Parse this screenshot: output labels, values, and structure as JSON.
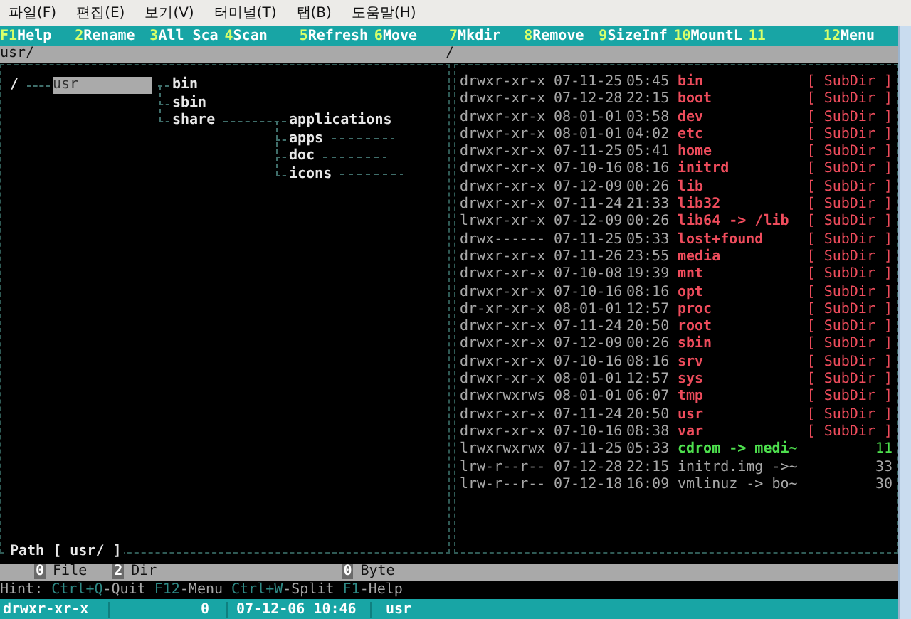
{
  "menu": [
    "파일(F)",
    "편집(E)",
    "보기(V)",
    "터미널(T)",
    "탭(B)",
    "도움말(H)"
  ],
  "function_keys": [
    {
      "key": "F1",
      "label": "Help"
    },
    {
      "key": "2",
      "label": "Rename"
    },
    {
      "key": "3",
      "label": "All Sca"
    },
    {
      "key": "4",
      "label": "Scan"
    },
    {
      "key": "5",
      "label": "Refresh"
    },
    {
      "key": "6",
      "label": "Move"
    },
    {
      "key": "7",
      "label": "Mkdir"
    },
    {
      "key": "8",
      "label": "Remove"
    },
    {
      "key": "9",
      "label": "SizeInf"
    },
    {
      "key": "10",
      "label": "MountL"
    },
    {
      "key": "11"
    },
    {
      "key": "12",
      "label": "Menu"
    }
  ],
  "path_bar": {
    "left": "usr/",
    "right": "/"
  },
  "tree": {
    "path_label": "Path [ usr/ ]",
    "nodes": [
      {
        "label": "/",
        "selected": false,
        "collapsed": false,
        "children": [
          {
            "label": "usr",
            "selected": true,
            "collapsed": false,
            "children": [
              {
                "label": "bin",
                "selected": false,
                "collapsed": false
              },
              {
                "label": "sbin",
                "selected": false,
                "collapsed": false
              },
              {
                "label": "share",
                "selected": false,
                "collapsed": false,
                "children": [
                  {
                    "label": "applications",
                    "selected": false,
                    "collapsed": false
                  },
                  {
                    "label": "apps",
                    "selected": false,
                    "collapsed": true
                  },
                  {
                    "label": "doc",
                    "selected": false,
                    "collapsed": true
                  },
                  {
                    "label": "icons",
                    "selected": false,
                    "collapsed": true
                  }
                ]
              }
            ]
          }
        ]
      }
    ]
  },
  "files": [
    {
      "perm": "drwxr-xr-x",
      "date": "07-11-25",
      "time": "05:45",
      "name": "bin",
      "info": "[ SubDir ]",
      "kind": "dir"
    },
    {
      "perm": "drwxr-xr-x",
      "date": "07-12-28",
      "time": "22:15",
      "name": "boot",
      "info": "[ SubDir ]",
      "kind": "dir"
    },
    {
      "perm": "drwxr-xr-x",
      "date": "08-01-01",
      "time": "03:58",
      "name": "dev",
      "info": "[ SubDir ]",
      "kind": "dir"
    },
    {
      "perm": "drwxr-xr-x",
      "date": "08-01-01",
      "time": "04:02",
      "name": "etc",
      "info": "[ SubDir ]",
      "kind": "dir"
    },
    {
      "perm": "drwxr-xr-x",
      "date": "07-11-25",
      "time": "05:41",
      "name": "home",
      "info": "[ SubDir ]",
      "kind": "dir"
    },
    {
      "perm": "drwxr-xr-x",
      "date": "07-10-16",
      "time": "08:16",
      "name": "initrd",
      "info": "[ SubDir ]",
      "kind": "dir"
    },
    {
      "perm": "drwxr-xr-x",
      "date": "07-12-09",
      "time": "00:26",
      "name": "lib",
      "info": "[ SubDir ]",
      "kind": "dir"
    },
    {
      "perm": "drwxr-xr-x",
      "date": "07-11-24",
      "time": "21:33",
      "name": "lib32",
      "info": "[ SubDir ]",
      "kind": "dir"
    },
    {
      "perm": "lrwxr-xr-x",
      "date": "07-12-09",
      "time": "00:26",
      "name": "lib64 -> /lib",
      "info": "[ SubDir ]",
      "kind": "dir"
    },
    {
      "perm": "drwx------",
      "date": "07-11-25",
      "time": "05:33",
      "name": "lost+found",
      "info": "[ SubDir ]",
      "kind": "dir"
    },
    {
      "perm": "drwxr-xr-x",
      "date": "07-11-26",
      "time": "23:55",
      "name": "media",
      "info": "[ SubDir ]",
      "kind": "dir"
    },
    {
      "perm": "drwxr-xr-x",
      "date": "07-10-08",
      "time": "19:39",
      "name": "mnt",
      "info": "[ SubDir ]",
      "kind": "dir"
    },
    {
      "perm": "drwxr-xr-x",
      "date": "07-10-16",
      "time": "08:16",
      "name": "opt",
      "info": "[ SubDir ]",
      "kind": "dir"
    },
    {
      "perm": "dr-xr-xr-x",
      "date": "08-01-01",
      "time": "12:57",
      "name": "proc",
      "info": "[ SubDir ]",
      "kind": "dir"
    },
    {
      "perm": "drwxr-xr-x",
      "date": "07-11-24",
      "time": "20:50",
      "name": "root",
      "info": "[ SubDir ]",
      "kind": "dir"
    },
    {
      "perm": "drwxr-xr-x",
      "date": "07-12-09",
      "time": "00:26",
      "name": "sbin",
      "info": "[ SubDir ]",
      "kind": "dir"
    },
    {
      "perm": "drwxr-xr-x",
      "date": "07-10-16",
      "time": "08:16",
      "name": "srv",
      "info": "[ SubDir ]",
      "kind": "dir"
    },
    {
      "perm": "drwxr-xr-x",
      "date": "08-01-01",
      "time": "12:57",
      "name": "sys",
      "info": "[ SubDir ]",
      "kind": "dir"
    },
    {
      "perm": "drwxrwxrws",
      "date": "08-01-01",
      "time": "06:07",
      "name": "tmp",
      "info": "[ SubDir ]",
      "kind": "dir"
    },
    {
      "perm": "drwxr-xr-x",
      "date": "07-11-24",
      "time": "20:50",
      "name": "usr",
      "info": "[ SubDir ]",
      "kind": "dir"
    },
    {
      "perm": "drwxr-xr-x",
      "date": "07-10-16",
      "time": "08:38",
      "name": "var",
      "info": "[ SubDir ]",
      "kind": "dir"
    },
    {
      "perm": "lrwxrwxrwx",
      "date": "07-11-25",
      "time": "05:33",
      "name": "cdrom -> medi~",
      "info": "11",
      "kind": "device_link"
    },
    {
      "perm": "lrw-r--r--",
      "date": "07-12-28",
      "time": "22:15",
      "name": "initrd.img ->~",
      "info": "33",
      "kind": "link"
    },
    {
      "perm": "lrw-r--r--",
      "date": "07-12-18",
      "time": "16:09",
      "name": "vmlinuz -> bo~",
      "info": "30",
      "kind": "link"
    }
  ],
  "summary": [
    {
      "count": "0",
      "label": "File"
    },
    {
      "count": "2",
      "label": "Dir"
    },
    {
      "count": "0",
      "label": "Byte"
    }
  ],
  "hint": {
    "prefix": "Hint:",
    "items": [
      {
        "key": "Ctrl+Q",
        "action": "-Quit"
      },
      {
        "key": "F12",
        "action": "-Menu"
      },
      {
        "key": "Ctrl+W",
        "action": "-Split"
      },
      {
        "key": "F1",
        "action": "-Help"
      }
    ]
  },
  "status": {
    "perm": "drwxr-xr-x",
    "size": "0",
    "datetime": "07-12-06 10:46",
    "name": "usr"
  }
}
